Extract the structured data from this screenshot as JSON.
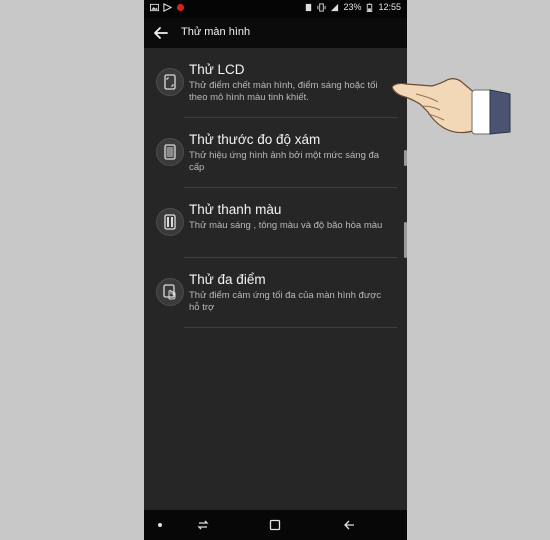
{
  "status_bar": {
    "left_icons": [
      "gallery-icon",
      "flag-icon",
      "record-icon"
    ],
    "battery": "23%",
    "time": "12:55"
  },
  "header": {
    "title": "Thử màn hình"
  },
  "items": [
    {
      "title": "Thử LCD",
      "desc": "Thử điểm chết màn hình, điểm sáng hoặc tối theo mô hình màu tinh khiết.",
      "icon": "lcd-icon"
    },
    {
      "title": "Thử thước đo độ xám",
      "desc": "Thử hiệu ứng hình ảnh bởi một mức sáng đa cấp",
      "icon": "grayscale-icon"
    },
    {
      "title": "Thử thanh màu",
      "desc": "Thử màu sáng , tông màu và độ bão hòa màu",
      "icon": "color-bar-icon"
    },
    {
      "title": "Thử đa điểm",
      "desc": "Thử điểm cảm ứng tối đa của màn hình được hỗ trợ",
      "icon": "multitouch-icon"
    }
  ],
  "colors": {
    "background": "#262626",
    "appbar": "#0b0b0b",
    "frame": "#c8c8c8"
  }
}
